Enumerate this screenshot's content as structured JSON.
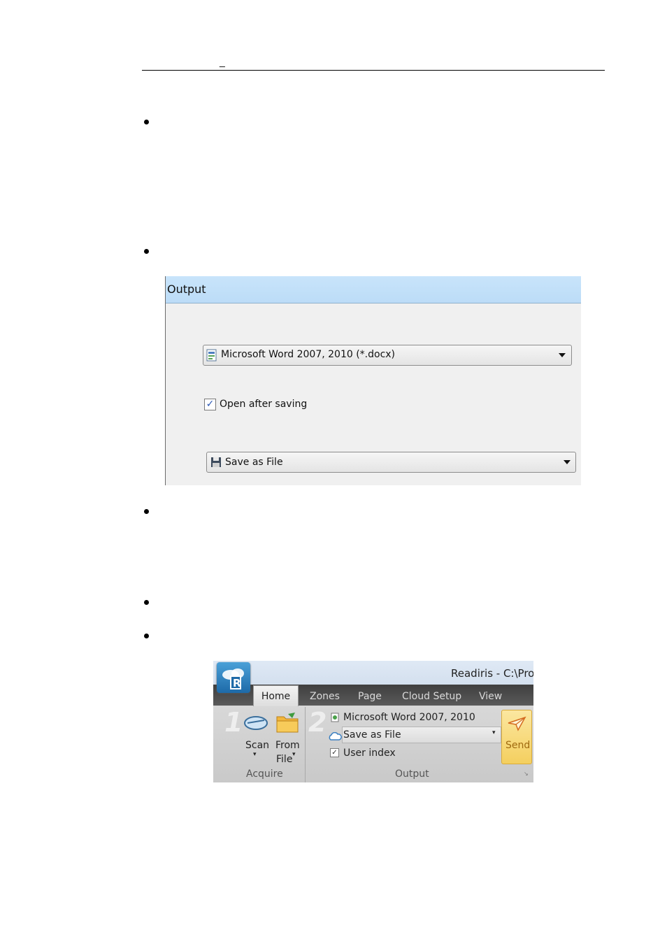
{
  "header": {
    "dash": "_"
  },
  "output_panel": {
    "title": "Output",
    "format_select": {
      "value": "Microsoft Word 2007, 2010 (*.docx)"
    },
    "open_after_saving": {
      "label": "Open after saving",
      "checked": true
    },
    "destination_select": {
      "value": "Save as File"
    }
  },
  "ribbon": {
    "window_title": "Readiris - C:\\Prog",
    "tabs": [
      "Home",
      "Zones",
      "Page",
      "Cloud Setup",
      "View"
    ],
    "active_tab": "Home",
    "acquire": {
      "step_number": "1",
      "scan_label": "Scan",
      "from_label": "From",
      "file_label": "File",
      "group_label": "Acquire"
    },
    "output": {
      "step_number": "2",
      "format": "Microsoft Word 2007, 2010",
      "destination": "Save as File",
      "user_index_label": "User index",
      "user_index_checked": true,
      "group_label": "Output",
      "send_label": "Send"
    }
  },
  "colors": {
    "output_titlebar": "#c8e4fb",
    "ribbon_tabbar": "#4a4a4a",
    "send_button": "#f7d774",
    "checkmark": "#2b58b5"
  }
}
